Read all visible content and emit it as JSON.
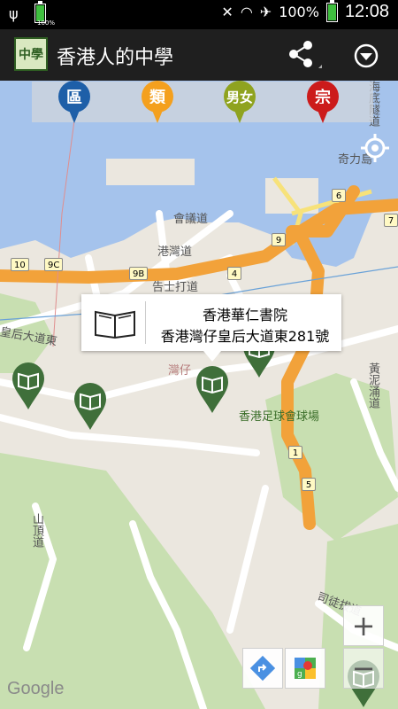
{
  "status_bar": {
    "battery_small_label": "100%",
    "battery_pct": "100%",
    "time": "12:08"
  },
  "app_bar": {
    "icon_text": "中學",
    "title": "香港人的中學",
    "share_icon": "share-icon",
    "overflow_icon": "dropdown-circle-icon"
  },
  "filters": [
    {
      "label": "區",
      "color": "#1e5fa8"
    },
    {
      "label": "類",
      "color": "#f4a01e"
    },
    {
      "label": "男女",
      "color": "#8fa31f"
    },
    {
      "label": "宗",
      "color": "#cc1b1b"
    }
  ],
  "info_window": {
    "name": "香港華仁書院",
    "address": "香港灣仔皇后大道東281號",
    "icon": "open-book-icon"
  },
  "map_labels": {
    "convention_road": "會議道",
    "harbour_road": "港灣道",
    "gloucester_road": "告士打道",
    "queens_road_east": "皇后大道東",
    "wan_chai": "灣仔",
    "stadium": "香港足球會球場",
    "peak_road": "山頂道",
    "kellett": "奇力島",
    "tunnel": "海底隧道",
    "wong_nai_chung": "黃泥涌道",
    "stubbs": "司徒拔道"
  },
  "route_shields": [
    "10",
    "9C",
    "9B",
    "4",
    "9",
    "6",
    "7",
    "1",
    "5"
  ],
  "map_controls": {
    "zoom_in": "+",
    "zoom_out": "−",
    "google": "Google"
  }
}
